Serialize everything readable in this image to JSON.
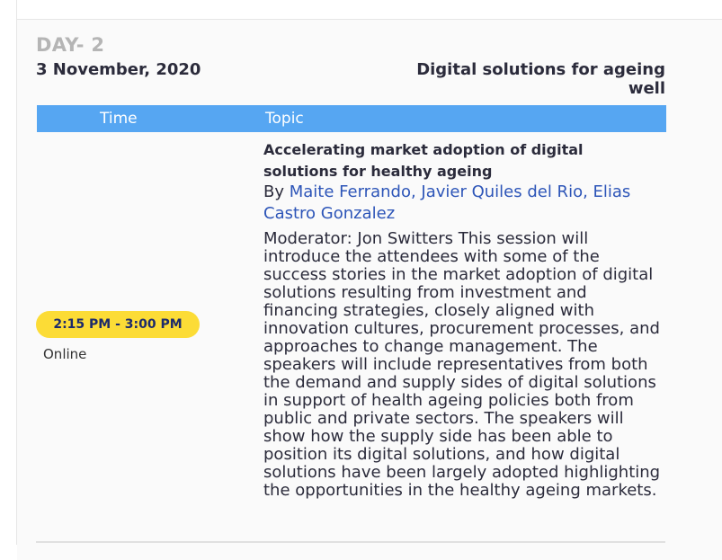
{
  "day": {
    "label": "DAY- 2",
    "date": "3 November, 2020",
    "track": "Digital solutions for ageing well"
  },
  "table": {
    "headers": {
      "time": "Time",
      "topic": "Topic"
    }
  },
  "session": {
    "time": "2:15 PM - 3:00 PM",
    "location": "Online",
    "title": "Accelerating market adoption of digital solutions for healthy ageing",
    "by_prefix": "By ",
    "speakers": "Maite Ferrando, Javier Quiles del Rio, Elias Castro Gonzalez",
    "description": "Moderator: Jon Switters This session will introduce the attendees with some of the success stories in the market adoption of digital solutions resulting from investment and financing strategies, closely aligned with innovation cultures, procurement processes, and approaches to change management. The speakers will include representatives from both the demand and supply sides of digital solutions in support of health ageing policies both from public and private sectors. The speakers will show how the supply side has been able to position its digital solutions, and how digital solutions have been largely adopted highlighting the opportunities in the healthy ageing markets."
  },
  "colors": {
    "header_bg": "#56a6f2",
    "badge_bg": "#fcdc36",
    "badge_text": "#1c2a6b",
    "link": "#2d55b8"
  }
}
